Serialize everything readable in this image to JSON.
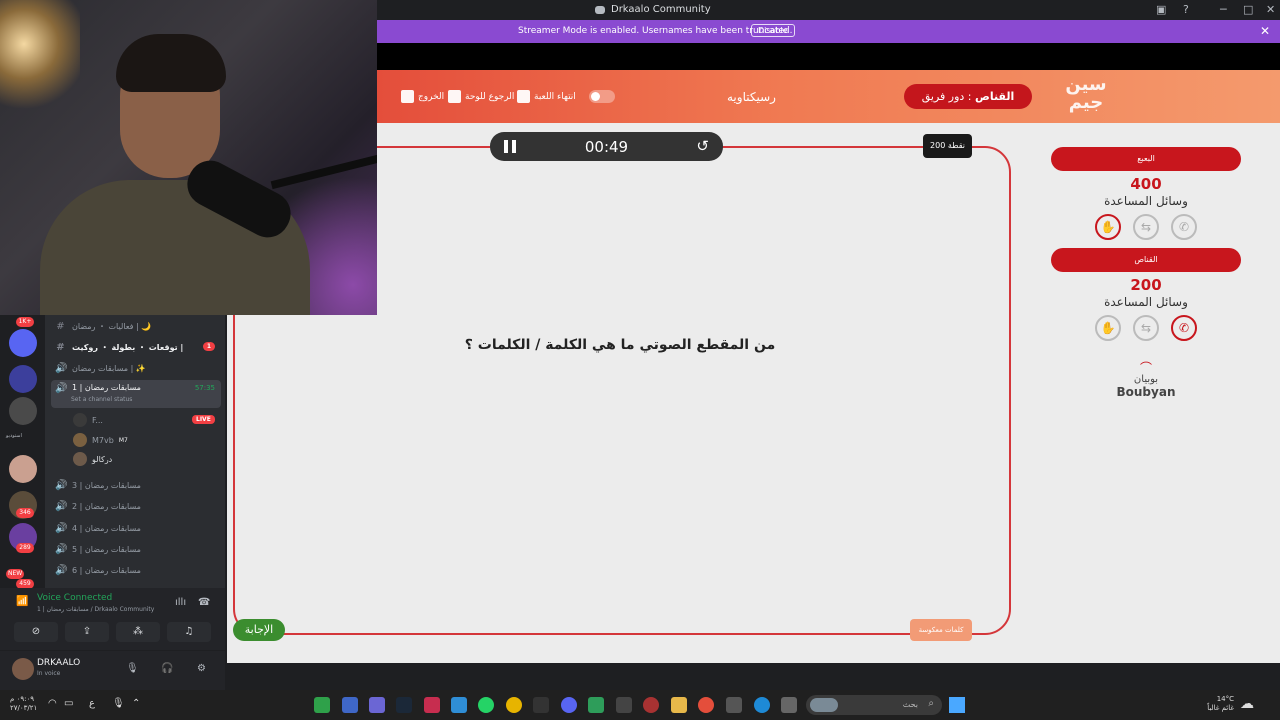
{
  "window": {
    "title": "Drkaalo Community",
    "controls": [
      "─",
      "□",
      "✕"
    ]
  },
  "streamer_banner": {
    "message": "Streamer Mode is enabled. Usernames have been truncated.",
    "button": "Disable"
  },
  "game_header": {
    "exit_label": "الخروج",
    "board_label": "الرجوع للوحة",
    "end_game_label": "انتهاء اللعبة",
    "game_name": "رسيكتاويه",
    "team_turn_prefix": "دور فريق :",
    "team_turn_name": "القناص",
    "logo_text": "سين جيم"
  },
  "game": {
    "timer": "00:49",
    "points": "200 نقطة",
    "question": "من المقطع الصوتي ما هي الكلمة / الكلمات ؟",
    "answer_button": "الإجابة",
    "hint_button": "كلمات معكوسة",
    "teams": [
      {
        "name": "البعبع",
        "score": "400",
        "aids_label": "وسائل المساعدة"
      },
      {
        "name": "القناص",
        "score": "200",
        "aids_label": "وسائل المساعدة"
      }
    ],
    "sponsor_ar": "بوبيان",
    "sponsor_en": "Boubyan"
  },
  "sidebar": {
    "channels": [
      {
        "label": "فعاليات ・ رمضان | 🌙",
        "icon": "#"
      },
      {
        "label": "توقعات ・ بطولة ・ روكيت |",
        "icon": "#",
        "badge": "1"
      },
      {
        "label": "مسابقات رمضان | ✨",
        "icon": "🔊"
      },
      {
        "label": "مسابقات رمضان | 1",
        "icon": "🔊",
        "time": "57:35",
        "status": "Set a channel status"
      },
      {
        "label": "مسابقات رمضان | 3",
        "icon": "🔊"
      },
      {
        "label": "مسابقات رمضان | 2",
        "icon": "🔊"
      },
      {
        "label": "مسابقات رمضان | 4",
        "icon": "🔊"
      },
      {
        "label": "مسابقات رمضان | 5",
        "icon": "🔊"
      },
      {
        "label": "مسابقات رمضان | 6",
        "icon": "🔊"
      }
    ],
    "voice_users": [
      {
        "name": "F..."
      },
      {
        "name": "M7vb",
        "tag": "M7"
      },
      {
        "name": "دركالو"
      }
    ],
    "live_badge": "LIVE",
    "server_badges": [
      "1K+",
      "346",
      "289",
      "NEW",
      "459"
    ],
    "server_label": "استوديو"
  },
  "voice_panel": {
    "status": "Voice Connected",
    "subtitle": "1 | مسابقات رمضان / Drkaalo Community"
  },
  "user_panel": {
    "username": "DRKAALO",
    "status": "In voice"
  },
  "taskbar": {
    "time": "٠٩:٠٩ م",
    "date": "٢٧/٠٣/٢١",
    "lang": "ع",
    "search_placeholder": "بحث",
    "temperature": "14°C",
    "weather_text": "غائم غالباً"
  }
}
